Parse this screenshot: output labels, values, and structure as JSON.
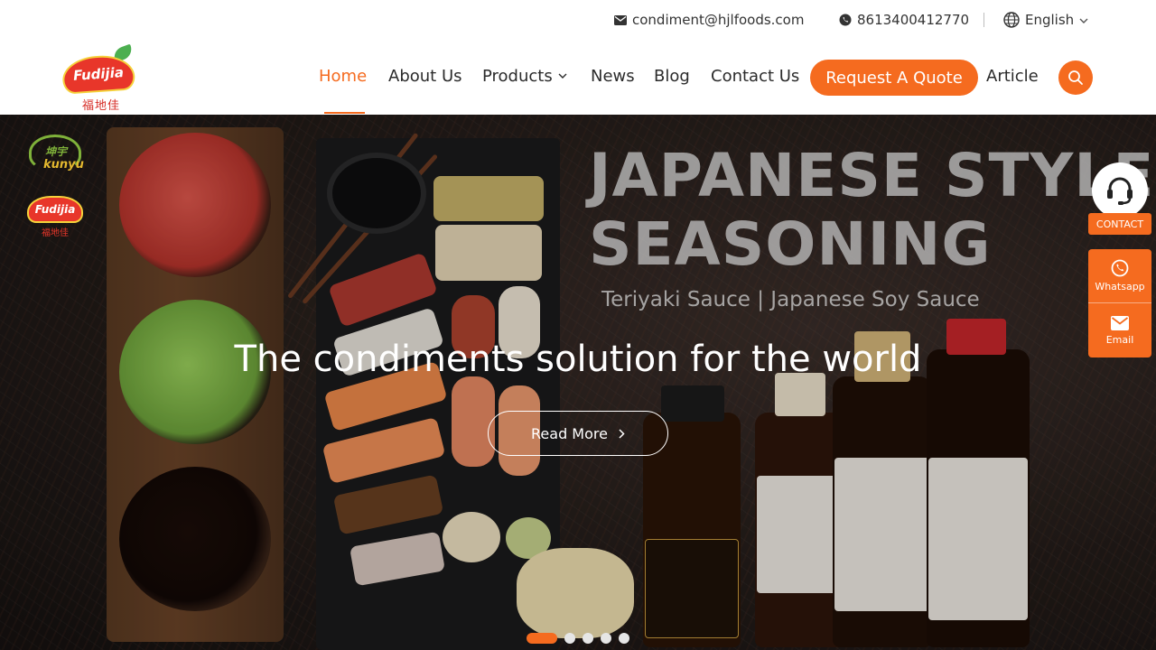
{
  "topbar": {
    "email": "condiment@hjlfoods.com",
    "phone": "8613400412770",
    "language": "English"
  },
  "logo": {
    "brand": "Fudijia",
    "brand_cn": "福地佳"
  },
  "nav": {
    "home": "Home",
    "about": "About Us",
    "products": "Products",
    "news": "News",
    "blog": "Blog",
    "contact": "Contact Us",
    "quote": "Request A Quote",
    "article": "Article"
  },
  "hero": {
    "heading_line1": "JAPANESE STYLE",
    "heading_line2": "SEASONING",
    "subheading": "Teriyaki Sauce | Japanese Soy Sauce",
    "tagline": "The condiments solution for the world",
    "button": "Read More",
    "side_logo_1": "kunyu",
    "side_logo_1_cn": "坤宇",
    "side_logo_2": "Fudijia",
    "side_logo_2_cn": "福地佳",
    "slide_count": 5,
    "active_slide": 1
  },
  "float": {
    "contact": "CONTACT",
    "whatsapp": "Whatsapp",
    "email": "Email"
  },
  "colors": {
    "accent": "#f56b1f",
    "text": "#2b2b2b",
    "hero_bg": "#231c19"
  }
}
